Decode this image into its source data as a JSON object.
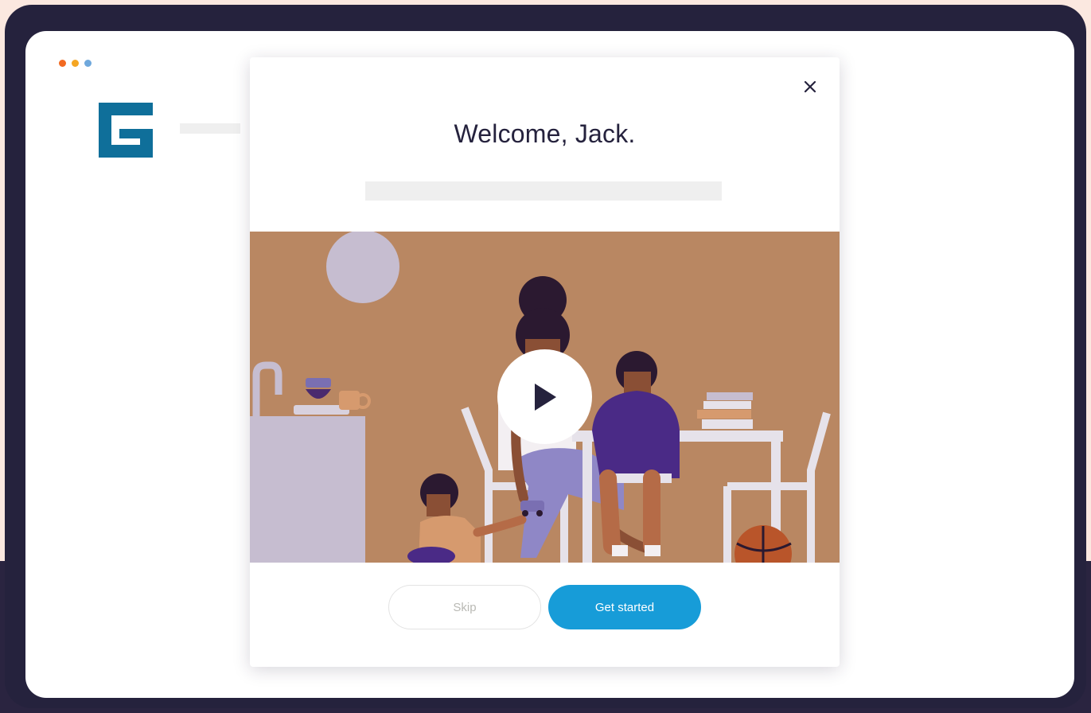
{
  "window": {
    "dots": [
      {
        "name": "red-dot",
        "color": "#f26a21"
      },
      {
        "name": "yellow-dot",
        "color": "#f5a623"
      },
      {
        "name": "blue-dot",
        "color": "#6fa8dc"
      }
    ]
  },
  "brand": {
    "logo_icon": "g-logo-icon",
    "logo_color": "#0f6f9a"
  },
  "modal": {
    "title": "Welcome, Jack.",
    "close_icon": "close-icon",
    "video": {
      "play_icon": "play-icon",
      "background_color": "#b98762"
    },
    "actions": {
      "skip_label": "Skip",
      "primary_label": "Get started",
      "primary_color": "#179cd8"
    }
  },
  "colors": {
    "frame": "#25223d",
    "page_background": "#fbe8e0"
  }
}
